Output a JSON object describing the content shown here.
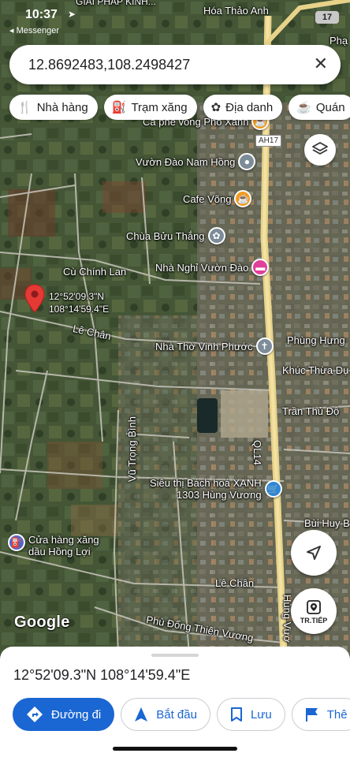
{
  "status_bar": {
    "time": "10:37",
    "back_app": "◂ Messenger",
    "battery": "17"
  },
  "search": {
    "value": "12.8692483,108.2498427"
  },
  "chips": [
    {
      "icon": "restaurant-icon",
      "label": "Nhà hàng"
    },
    {
      "icon": "gas-station-icon",
      "label": "Trạm xăng"
    },
    {
      "icon": "landmark-icon",
      "label": "Địa danh"
    },
    {
      "icon": "cafe-icon",
      "label": "Quán"
    }
  ],
  "map": {
    "top_labels": {
      "top_partial": "GIẢI PHÁP KINH...",
      "hoa_thao_anh": "Hóa Thảo Anh",
      "pha": "Phạ"
    },
    "pois": {
      "ca_phe": "Cà phê võng Phố Xanh",
      "vuon_dao": "Vườn Đào Nam Hồng",
      "cafe_vong": "Cafe Võng",
      "chua": "Chùa Bửu Thắng",
      "nha_nghi": "Nhà Nghỉ Vườn Đào",
      "nha_tho": "Nhà Thờ Vinh Phước",
      "sieu_thi": "Siêu thị Bách hoá XANH",
      "sieu_thi_addr": "1303 Hùng Vương",
      "cua_hang_1": "Cửa hàng xăng",
      "cua_hang_2": "dầu Hồng Lợi"
    },
    "roads": {
      "ah17": "AH17",
      "cu_chinh_lan": "Cù Chính Lan",
      "le_chan_1": "Lê Chân",
      "phung_hung": "Phùng Hưng",
      "khuc_thua_du": "Khúc Thừa Dụ",
      "tran_thu_do": "Trần Thủ Độ",
      "ql14": "QL14",
      "vu_trong_binh": "Vũ Trọng Bình",
      "bui_huy": "Bùi Huy B",
      "le_chan_2": "Lê Chân",
      "phu_dong": "Phù Đổng Thiên Vương",
      "hung_vuong": "Hùng Vươ"
    },
    "pin": {
      "lat": "12°52'09.3\"N",
      "lng": "108°14'59.4\"E"
    },
    "next_label": "TR.TIẾP",
    "google": "Google"
  },
  "sheet": {
    "coords": "12°52'09.3\"N 108°14'59.4\"E",
    "actions": [
      {
        "icon": "directions-icon",
        "label": "Đường đi",
        "primary": true
      },
      {
        "icon": "navigation-arrow-icon",
        "label": "Bắt đầu",
        "primary": false
      },
      {
        "icon": "bookmark-icon",
        "label": "Lưu",
        "primary": false
      },
      {
        "icon": "flag-icon",
        "label": "Thê",
        "primary": false
      }
    ]
  },
  "colors": {
    "accent": "#1a66d2",
    "pin": "#e53935",
    "highway": "#e8d28a",
    "poi_orange": "#f29a1f",
    "poi_pink": "#e0409a",
    "poi_blue": "#2e86d6"
  }
}
